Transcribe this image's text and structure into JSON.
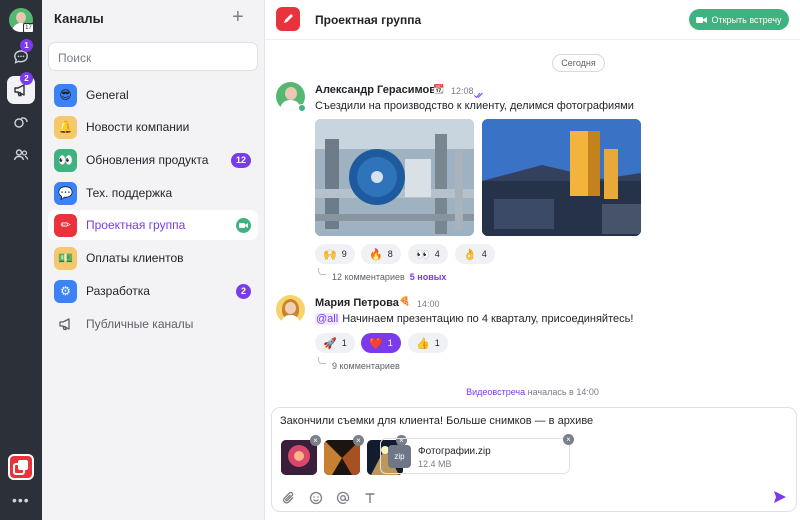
{
  "rail": {
    "cal_day": "17",
    "badge_chats": "1",
    "badge_channels": "2",
    "more": "•••"
  },
  "panel": {
    "title": "Каналы",
    "add": "+",
    "search_placeholder": "Поиск",
    "channels": [
      {
        "label": "General",
        "icon": "😎",
        "color": "#3b82f6"
      },
      {
        "label": "Новости компании",
        "icon": "🔔",
        "color": "#f6c86e"
      },
      {
        "label": "Обновления продукта",
        "icon": "👀",
        "color": "#3fb37f",
        "count": "12"
      },
      {
        "label": "Тех. поддержка",
        "icon": "💬",
        "color": "#3b82f6"
      },
      {
        "label": "Проектная группа",
        "icon": "✏",
        "color": "#e8323c"
      },
      {
        "label": "Оплаты клиентов",
        "icon": "💵",
        "color": "#f6c86e"
      },
      {
        "label": "Разработка",
        "icon": "⚙",
        "color": "#3b82f6",
        "count": "2"
      },
      {
        "label": "Публичные каналы",
        "icon": "megaphone-icon"
      }
    ]
  },
  "chat": {
    "title": "Проектная группа",
    "meet_button": "Открыть встречу",
    "today": "Сегодня",
    "msg1": {
      "name": "Александр Герасимов",
      "name_icon": "📆",
      "time": "12:08",
      "text": "Съездили на производство к клиенту, делимся фотографиями",
      "reactions": [
        {
          "e": "🙌",
          "n": "9"
        },
        {
          "e": "🔥",
          "n": "8"
        },
        {
          "e": "👀",
          "n": "4"
        },
        {
          "e": "👌",
          "n": "4"
        }
      ],
      "thread": "12 комментариев",
      "thread_new": "5 новых"
    },
    "msg2": {
      "name": "Мария Петрова",
      "name_icon": "🍕",
      "time": "14:00",
      "mention": "@all",
      "text": " Начинаем презентацию по 4 кварталу, присоединяйтесь!",
      "reactions": [
        {
          "e": "🚀",
          "n": "1"
        },
        {
          "e": "❤️",
          "n": "1"
        },
        {
          "e": "👍",
          "n": "1"
        }
      ],
      "thread": "9 комментариев"
    },
    "system": {
      "link": "Видеовстреча",
      "rest": " началась в 14:00"
    }
  },
  "composer": {
    "text": "Закончили съемки для клиента! Больше снимков — в архиве",
    "file": {
      "name": "Фотографии.zip",
      "size": "12.4 MB",
      "ext": "zip"
    }
  }
}
